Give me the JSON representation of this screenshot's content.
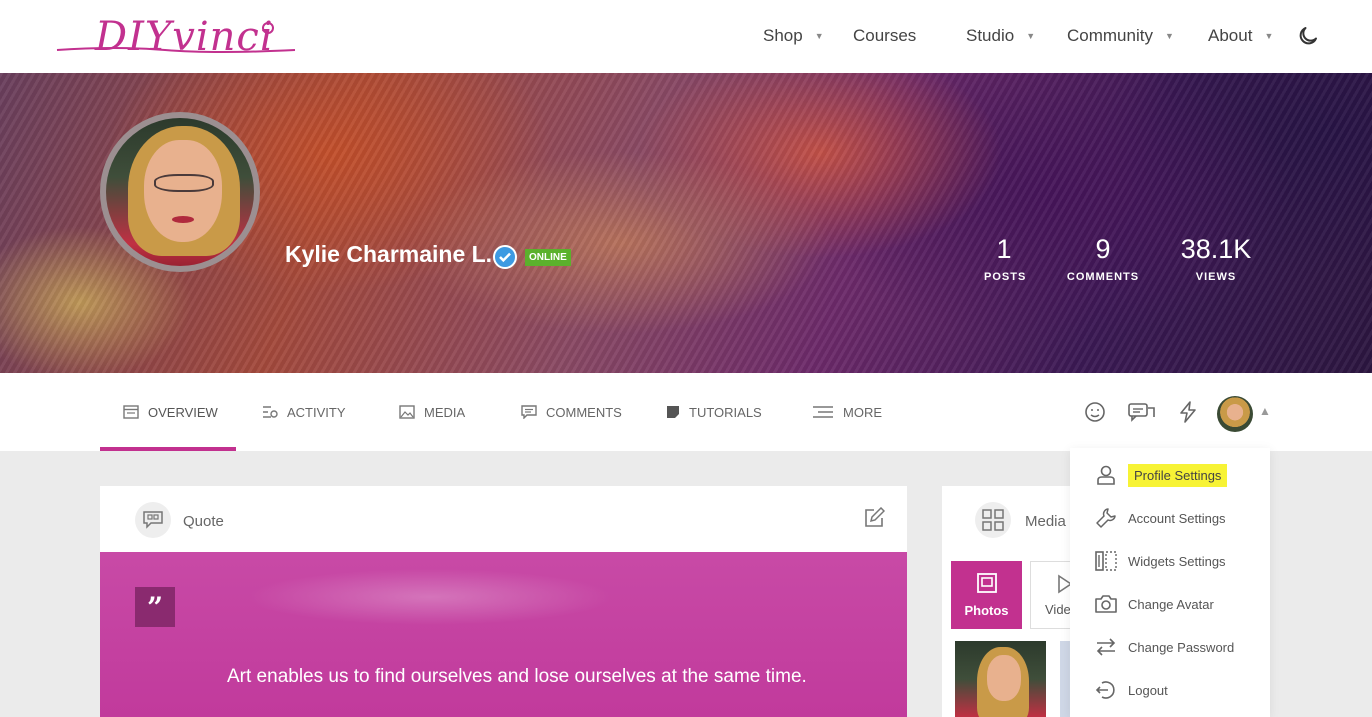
{
  "brand": {
    "logo_text": "DIYvinci",
    "accent": "#c2318f"
  },
  "nav": {
    "items": [
      {
        "label": "Shop",
        "has_caret": true
      },
      {
        "label": "Courses",
        "has_caret": false
      },
      {
        "label": "Studio",
        "has_caret": true
      },
      {
        "label": "Community",
        "has_caret": true
      },
      {
        "label": "About",
        "has_caret": true
      }
    ],
    "theme_icon": "moon-icon"
  },
  "profile": {
    "name": "Kylie Charmaine L.",
    "status": "ONLINE",
    "status_color": "#5bb12c",
    "stats": [
      {
        "value": "1",
        "label": "POSTS"
      },
      {
        "value": "9",
        "label": "COMMENTS"
      },
      {
        "value": "38.1K",
        "label": "VIEWS"
      }
    ]
  },
  "tabs": [
    {
      "label": "OVERVIEW",
      "icon": "overview-icon",
      "active": true
    },
    {
      "label": "ACTIVITY",
      "icon": "activity-icon"
    },
    {
      "label": "MEDIA",
      "icon": "media-icon"
    },
    {
      "label": "COMMENTS",
      "icon": "comments-icon"
    },
    {
      "label": "TUTORIALS",
      "icon": "tutorials-icon"
    },
    {
      "label": "MORE",
      "icon": "more-icon"
    }
  ],
  "toolbar_icons": [
    "smiley-icon",
    "messages-icon",
    "flash-icon",
    "user-avatar"
  ],
  "quote_card": {
    "header": "Quote",
    "quote_symbol": "”",
    "text": "Art enables us to find ourselves and lose ourselves at the same time."
  },
  "media_card": {
    "header": "Media",
    "tabs": [
      {
        "label": "Photos",
        "active": true
      },
      {
        "label": "Videos"
      }
    ]
  },
  "dropdown": {
    "items": [
      {
        "label": "Profile Settings",
        "icon": "user-icon",
        "highlighted": true
      },
      {
        "label": "Account Settings",
        "icon": "wrench-icon"
      },
      {
        "label": "Widgets Settings",
        "icon": "widgets-icon"
      },
      {
        "label": "Change Avatar",
        "icon": "camera-icon"
      },
      {
        "label": "Change Password",
        "icon": "arrows-icon"
      },
      {
        "label": "Logout",
        "icon": "logout-icon"
      }
    ]
  }
}
